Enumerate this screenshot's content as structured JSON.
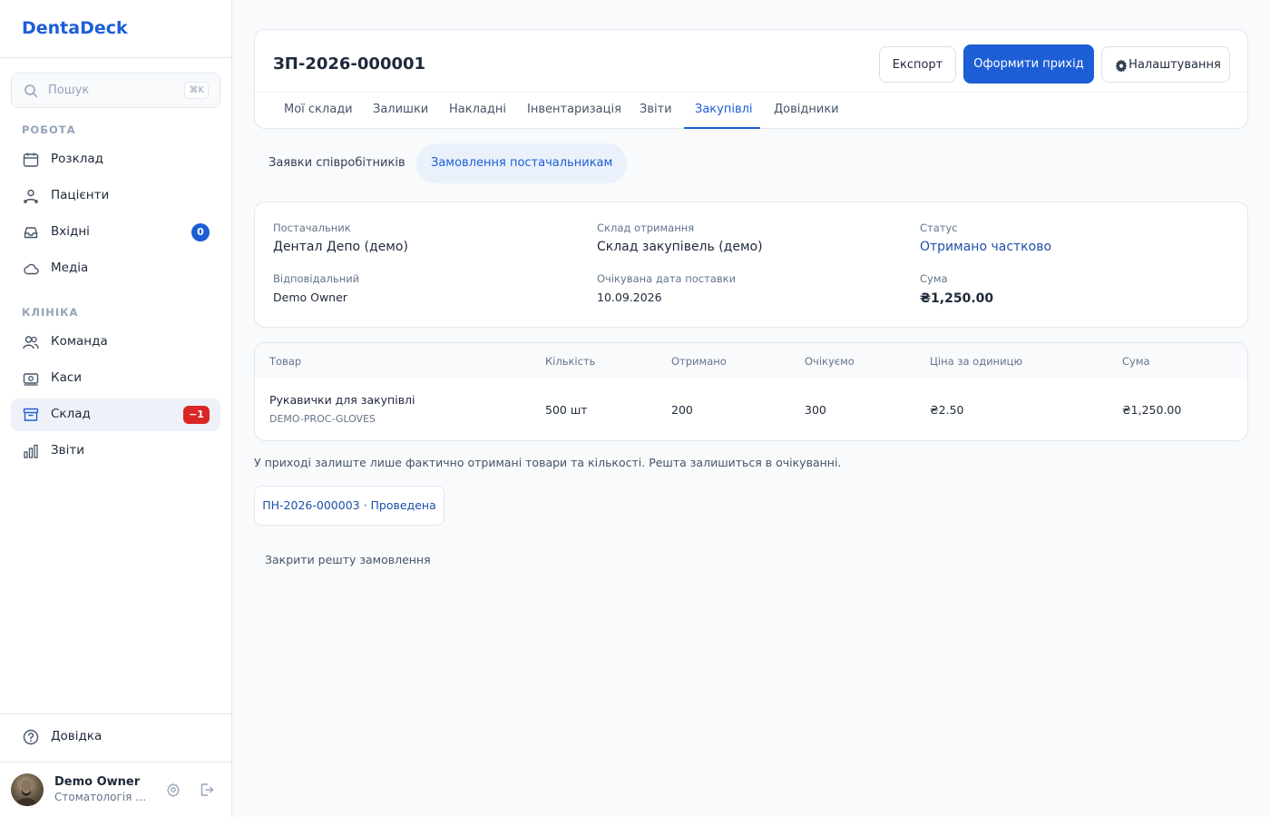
{
  "sidebar": {
    "brand": "DentaDeck",
    "search": {
      "placeholder": "Пошук",
      "shortcut": "⌘K"
    },
    "sections": [
      {
        "label": "РОБОТА"
      },
      {
        "label": "КЛІНІКА"
      }
    ],
    "items": [
      {
        "label": "Розклад",
        "icon": "calendar-icon"
      },
      {
        "label": "Пацієнти",
        "icon": "patients-icon"
      },
      {
        "label": "Вхідні",
        "icon": "inbox-icon",
        "badge": "0"
      },
      {
        "label": "Медіа",
        "icon": "cloud-icon"
      },
      {
        "label": "Команда",
        "icon": "team-icon"
      },
      {
        "label": "Каси",
        "icon": "cash-icon"
      },
      {
        "label": "Склад",
        "icon": "warehouse-icon",
        "badge": "−1",
        "active": true
      },
      {
        "label": "Звіти",
        "icon": "chart-icon"
      }
    ],
    "help": "Довідка",
    "user": {
      "name": "Demo Owner",
      "org": "Стоматологія Посмішка"
    }
  },
  "header": {
    "title": "ЗП-2026-000001",
    "export_label": "Експорт",
    "receive_label": "Оформити прихід",
    "settings_label": "Налаштування"
  },
  "tabs": [
    {
      "label": "Мої склади"
    },
    {
      "label": "Залишки"
    },
    {
      "label": "Накладні"
    },
    {
      "label": "Інвентаризація"
    },
    {
      "label": "Звіти"
    },
    {
      "label": "Закупівлі",
      "active": true
    },
    {
      "label": "Довідники"
    }
  ],
  "subtabs": [
    {
      "label": "Заявки співробітників"
    },
    {
      "label": "Замовлення постачальникам",
      "active": true
    }
  ],
  "details": {
    "supplier_label": "Постачальник",
    "supplier": "Дентал Депо (демо)",
    "warehouse_label": "Склад отримання",
    "warehouse": "Склад закупівель (демо)",
    "status_label": "Статус",
    "status": "Отримано частково",
    "responsible_label": "Відповідальний",
    "responsible": "Demo Owner",
    "date_label": "Очікувана дата поставки",
    "date": "10.09.2026",
    "sum_label": "Сума",
    "sum": "₴1,250.00"
  },
  "table": {
    "columns": [
      "Товар",
      "Кількість",
      "Отримано",
      "Очікуємо",
      "Ціна за одиницю",
      "Сума"
    ],
    "rows": [
      {
        "name": "Рукавички для закупівлі",
        "sku": "DEMO-PROC-GLOVES",
        "qty": "500 шт",
        "received": "200",
        "expected": "300",
        "price": "₴2.50",
        "sum": "₴1,250.00"
      }
    ]
  },
  "hint": "У приході залиште лише фактично отримані товари та кількості. Решта залишиться в очікуванні.",
  "receipt_link": "ПН-2026-000003 · Проведена",
  "close_rest": "Закрити решту замовлення",
  "colors": {
    "accent": "#1d5ed6",
    "danger": "#dc2626"
  }
}
